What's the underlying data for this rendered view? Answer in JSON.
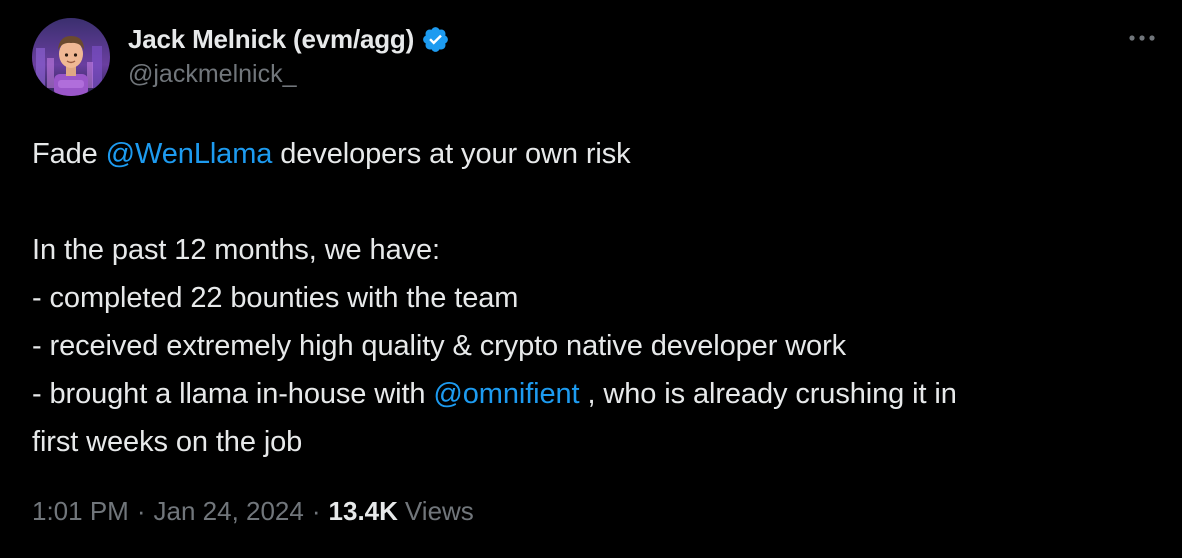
{
  "author": {
    "display_name": "Jack Melnick (evm/agg)",
    "handle": "@jackmelnick_",
    "verified": true,
    "verified_color": "#1d9bf0",
    "avatar": "avatar-image"
  },
  "more_icon": "ellipsis-icon",
  "tweet": {
    "line1": {
      "pre": "Fade ",
      "mention": "@WenLlama",
      "post": " developers at your own risk"
    },
    "line2": "In the past 12 months, we have:",
    "line3": "- completed 22 bounties with the team",
    "line4": "- received extremely high quality & crypto native developer work",
    "line5": {
      "pre": "- brought a llama in-house with ",
      "mention": "@omnifient",
      "post": " , who is already crushing it in"
    },
    "line6": "first weeks on the job"
  },
  "meta": {
    "time": "1:01 PM",
    "separator": "·",
    "date": "Jan 24, 2024",
    "views_count": "13.4K",
    "views_label": "Views"
  },
  "colors": {
    "background": "#000000",
    "text": "#e7e9ea",
    "secondary": "#71767b",
    "link": "#1d9bf0"
  }
}
